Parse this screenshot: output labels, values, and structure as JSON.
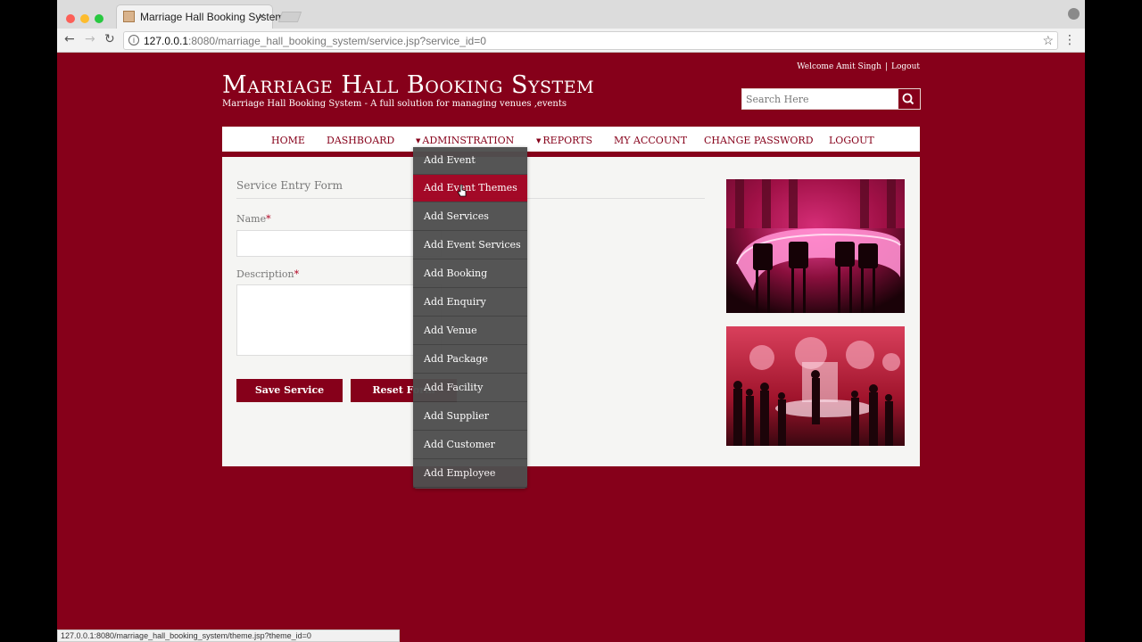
{
  "browser": {
    "tab_title": "Marriage Hall Booking System",
    "tab_close": "×",
    "url_host": "127.0.0.1",
    "url_rest": ":8080/marriage_hall_booking_system/service.jsp?service_id=0",
    "status_url": "127.0.0.1:8080/marriage_hall_booking_system/theme.jsp?theme_id=0"
  },
  "header": {
    "welcome": "Welcome Amit Singh",
    "separator": "|",
    "logout_link": "Logout",
    "title": "Marriage Hall Booking System",
    "subtitle": "Marriage Hall Booking System - A full solution for managing venues ,events",
    "search_placeholder": "Search Here"
  },
  "nav": {
    "items": [
      "HOME",
      "DASHBOARD",
      "ADMINSTRATION",
      "REPORTS",
      "MY ACCOUNT",
      "CHANGE PASSWORD",
      "LOGOUT"
    ]
  },
  "form": {
    "heading": "Service Entry Form",
    "name_label": "Name",
    "description_label": "Description",
    "required_mark": "*",
    "save_button": "Save Service",
    "reset_button": "Reset Form"
  },
  "dropdown": {
    "items": [
      "Add Event",
      "Add Event Themes",
      "Add Services",
      "Add Event Services",
      "Add Booking",
      "Add Enquiry",
      "Add Venue",
      "Add Package",
      "Add Facility",
      "Add Supplier",
      "Add Customer",
      "Add Employee"
    ],
    "active_index": 1
  },
  "colors": {
    "brand": "#86001a",
    "dropdown_bg": "#4f4f4f",
    "active_item": "#a0001f"
  }
}
